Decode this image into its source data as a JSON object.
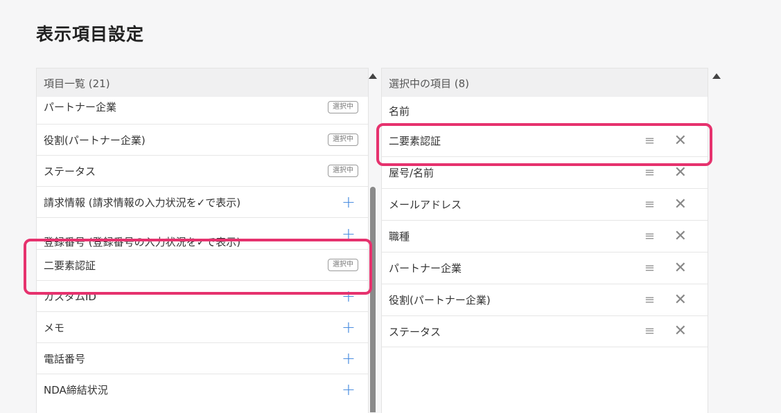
{
  "page": {
    "title": "表示項目設定"
  },
  "left_panel": {
    "header": "項目一覧 (21)",
    "items": [
      {
        "label": "パートナー企業",
        "status": "選択中"
      },
      {
        "label": "役割(パートナー企業)",
        "status": "選択中"
      },
      {
        "label": "ステータス",
        "status": "選択中"
      },
      {
        "label": "請求情報 (請求情報の入力状況を✓で表示)",
        "action": "+"
      },
      {
        "label": "登録番号 (登録番号の入力状況を✓で表示)",
        "action": "+"
      },
      {
        "label": "二要素認証",
        "status": "選択中"
      },
      {
        "label": "カスタムID",
        "action": "+"
      },
      {
        "label": "メモ",
        "action": "+"
      },
      {
        "label": "電話番号",
        "action": "+"
      },
      {
        "label": "NDA締結状況",
        "action": "+"
      }
    ]
  },
  "right_panel": {
    "header": "選択中の項目 (8)",
    "items": [
      {
        "label": "名前"
      },
      {
        "label": "二要素認証"
      },
      {
        "label": "屋号/名前"
      },
      {
        "label": "メールアドレス"
      },
      {
        "label": "職種"
      },
      {
        "label": "パートナー企業"
      },
      {
        "label": "役割(パートナー企業)"
      },
      {
        "label": "ステータス"
      }
    ],
    "drag_icon": "≡",
    "remove_icon": "✕"
  },
  "colors": {
    "highlight": "#e6326e",
    "plus_icon": "#4a8de0",
    "background": "#f6f6f7"
  }
}
